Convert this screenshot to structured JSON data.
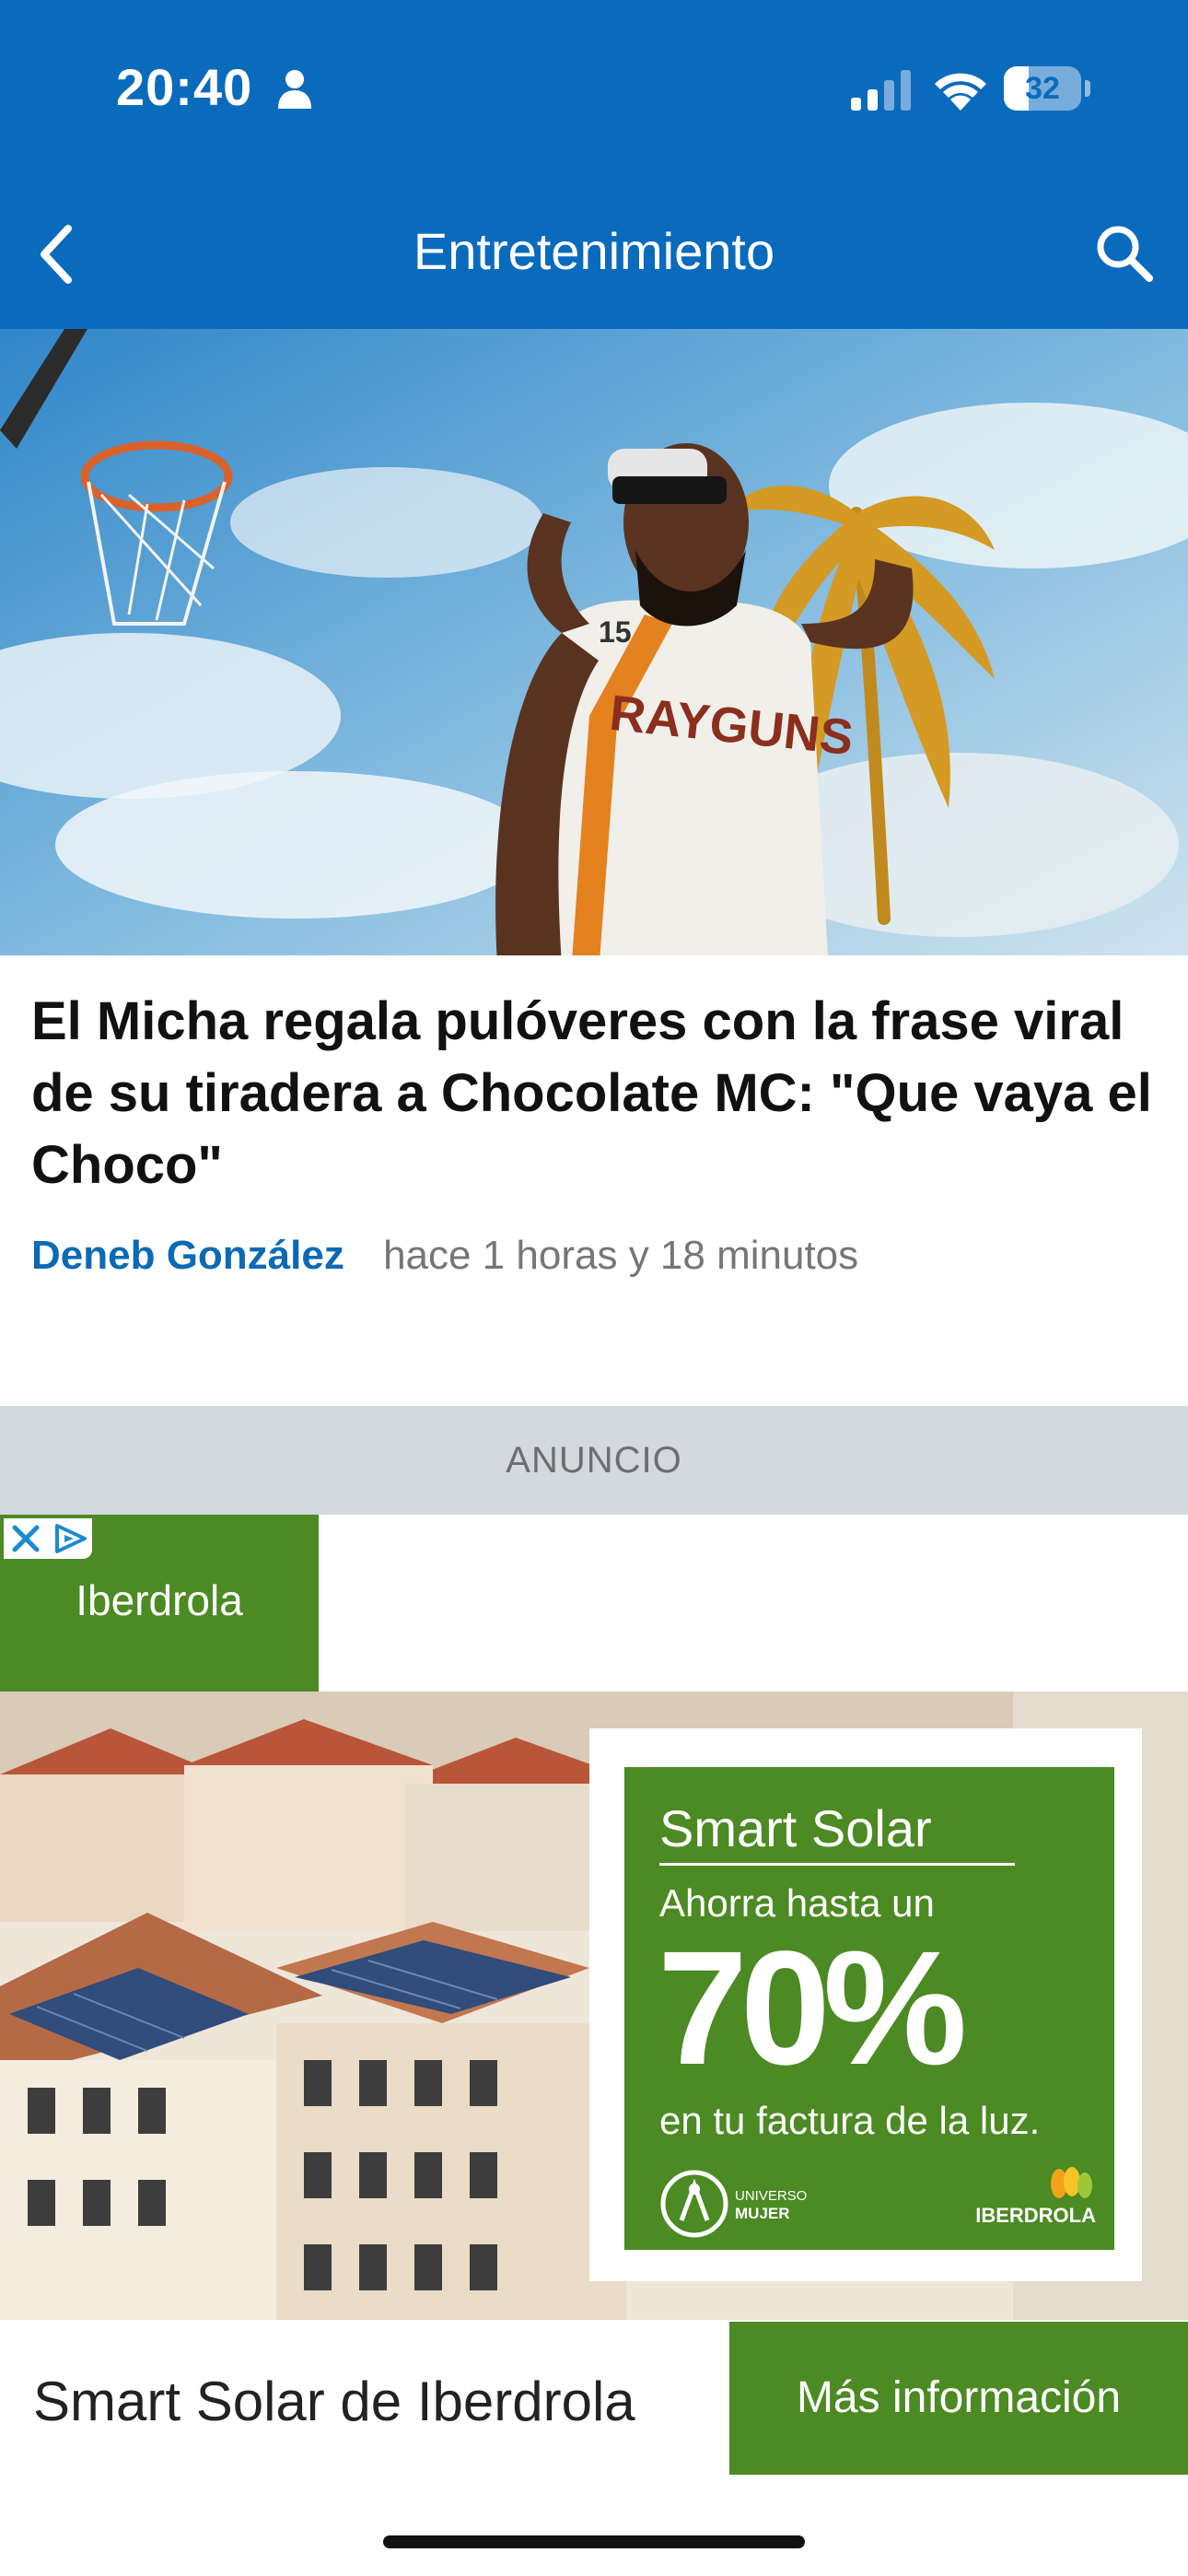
{
  "status_bar": {
    "time": "20:40",
    "battery": "32",
    "battery_level": 0.32
  },
  "nav": {
    "title": "Entretenimiento"
  },
  "article": {
    "headline": "El Micha regala pulóveres con la frase viral de su tiradera a Chocolate MC: \"Que vaya el Choco\"",
    "author": "Deneb González",
    "time": "hace 1 horas y 18 minutos",
    "jersey_number": "15",
    "jersey_text": "RAYGUNS"
  },
  "ad": {
    "label": "ANUNCIO",
    "brand": "Iberdrola",
    "promo_title": "Smart Solar",
    "promo_sub": "Ahorra hasta un",
    "promo_big": "70%",
    "promo_foot": "en tu factura de la luz.",
    "logo_left": "UNIVERSO MUJER",
    "logo_right": "IBERDROLA",
    "bottom_title": "Smart Solar de Iberdrola",
    "cta": "Más información"
  },
  "colors": {
    "header": "#0a6bbd",
    "author": "#0b6ab6",
    "ad_green": "#4c8a23",
    "ad_label_bg": "#d3d9df"
  },
  "icons": {
    "back": "chevron-left-icon",
    "search": "search-icon",
    "person": "person-icon",
    "ad_choices": "close-icon"
  }
}
